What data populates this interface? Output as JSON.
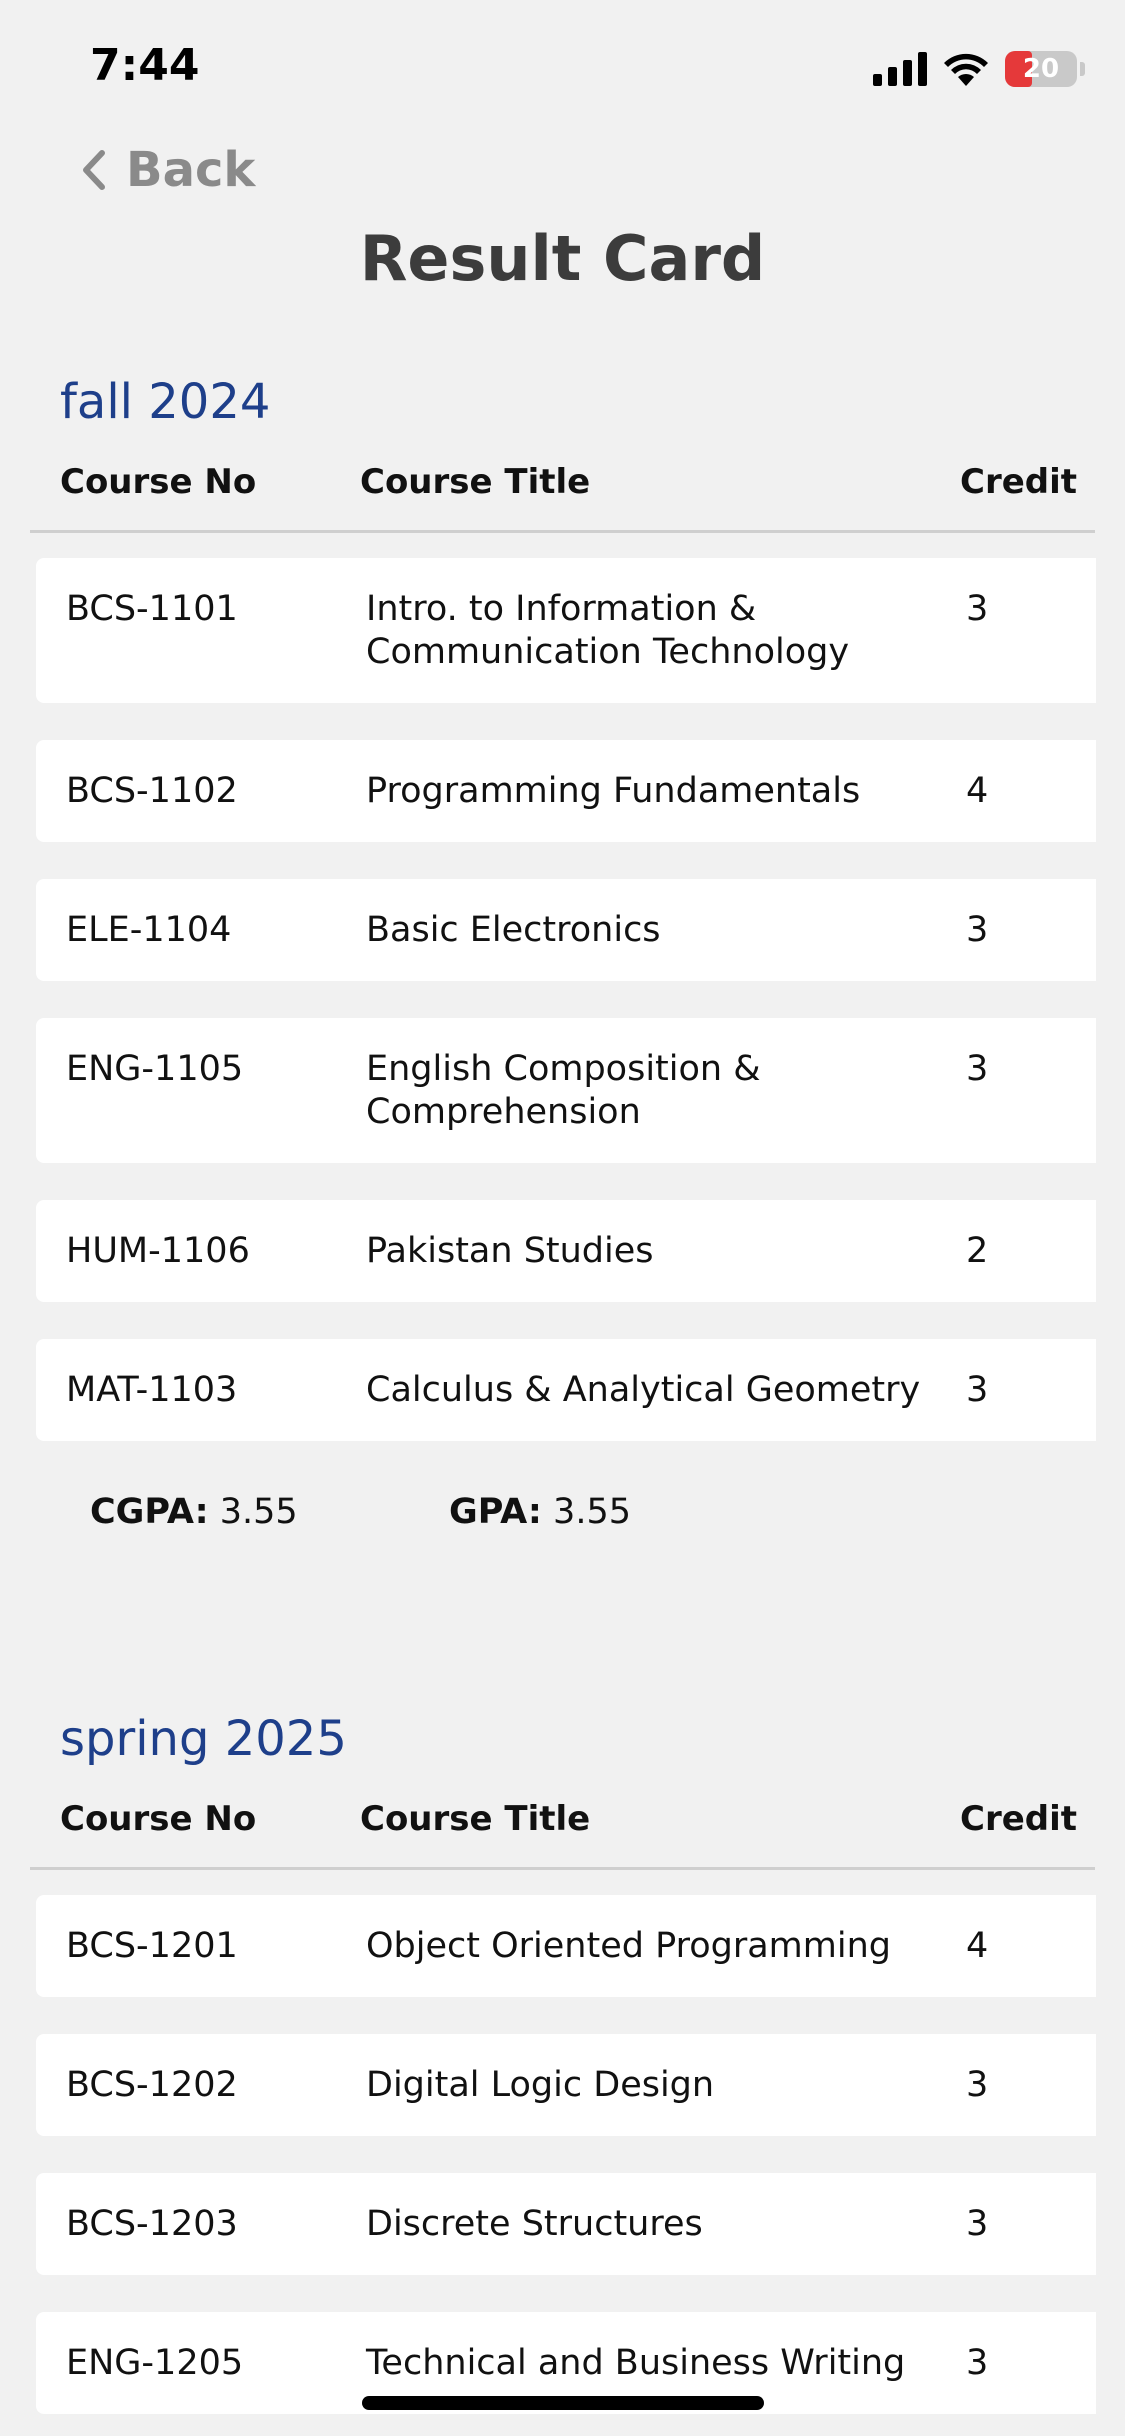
{
  "status_bar": {
    "time": "7:44",
    "battery_level": "20"
  },
  "nav": {
    "back_label": "Back",
    "title": "Result Card"
  },
  "table_headers": {
    "course_no": "Course No",
    "course_title": "Course Title",
    "credit": "Credit"
  },
  "semesters": [
    {
      "title": "fall 2024",
      "courses": [
        {
          "no": "BCS-1101",
          "title": "Intro. to Information & Communication Technology",
          "credit": "3"
        },
        {
          "no": "BCS-1102",
          "title": "Programming Fundamentals",
          "credit": "4"
        },
        {
          "no": "ELE-1104",
          "title": "Basic Electronics",
          "credit": "3"
        },
        {
          "no": "ENG-1105",
          "title": "English Composition & Comprehension",
          "credit": "3"
        },
        {
          "no": "HUM-1106",
          "title": "Pakistan Studies",
          "credit": "2"
        },
        {
          "no": "MAT-1103",
          "title": "Calculus & Analytical Geometry",
          "credit": "3"
        }
      ],
      "cgpa_label": "CGPA:",
      "cgpa": "3.55",
      "gpa_label": "GPA:",
      "gpa": "3.55"
    },
    {
      "title": "spring 2025",
      "courses": [
        {
          "no": "BCS-1201",
          "title": "Object Oriented Programming",
          "credit": "4"
        },
        {
          "no": "BCS-1202",
          "title": "Digital Logic Design",
          "credit": "3"
        },
        {
          "no": "BCS-1203",
          "title": "Discrete Structures",
          "credit": "3"
        },
        {
          "no": "ENG-1205",
          "title": "Technical and Business Writing",
          "credit": "3"
        }
      ]
    }
  ]
}
